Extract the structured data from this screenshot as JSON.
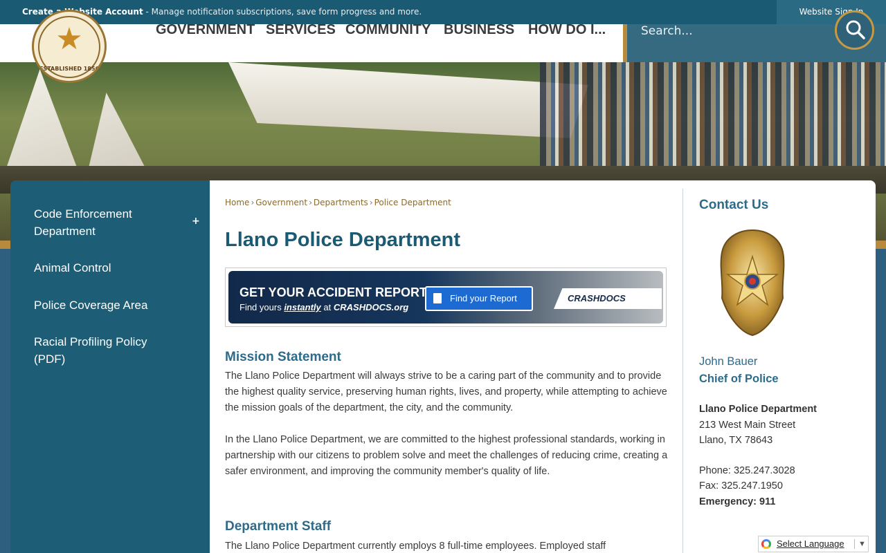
{
  "topbar": {
    "create_account": "Create a Website Account",
    "create_desc": " - Manage notification subscriptions, save form progress and more.",
    "sign_in": "Website Sign In"
  },
  "logo": {
    "est": "ESTABLISHED 1856"
  },
  "nav": [
    "GOVERNMENT",
    "SERVICES",
    "COMMUNITY",
    "BUSINESS",
    "HOW DO I..."
  ],
  "search": {
    "placeholder": "Search..."
  },
  "sidebar": {
    "items": [
      {
        "label": "Code Enforcement Department"
      },
      {
        "label": "Animal Control"
      },
      {
        "label": "Police Coverage Area"
      },
      {
        "label": "Racial Profiling Policy (PDF)"
      }
    ],
    "expand_symbol": "+"
  },
  "breadcrumb": [
    "Home",
    "Government",
    "Departments",
    "Police Department"
  ],
  "page_title": "Llano Police Department",
  "banner": {
    "headline": "GET YOUR ACCIDENT REPORT",
    "sub_prefix": "Find yours ",
    "sub_em": "instantly",
    "sub_mid": " at ",
    "sub_site": "CRASHDOCS.org",
    "button": "Find your Report",
    "logo_text": "CRASHDOCS"
  },
  "mission": {
    "heading": "Mission Statement",
    "p1": "The Llano Police Department will always strive to be a caring part of the community and to provide the highest quality service, preserving human rights, lives, and property, while attempting to achieve the mission goals of the department, the city, and the community.",
    "p2": "In the Llano Police Department, we are committed to the highest professional standards, working in partnership with our citizens to problem solve and meet the challenges of reducing crime, creating a safer environment, and improving the community member's quality of life."
  },
  "staff": {
    "heading": "Department Staff",
    "p1": "The Llano Police Department currently employs 8 full-time employees. Employed staff"
  },
  "contact": {
    "title": "Contact Us",
    "name": "John Bauer",
    "role": "Chief of Police",
    "org": "Llano Police Department",
    "street": "213 West Main Street",
    "city": "Llano, TX 78643",
    "phone": "Phone:  325.247.3028",
    "fax": "Fax: 325.247.1950",
    "emergency": "Emergency: 911"
  },
  "translate": {
    "label": "Select Language",
    "arrow": "▼"
  }
}
